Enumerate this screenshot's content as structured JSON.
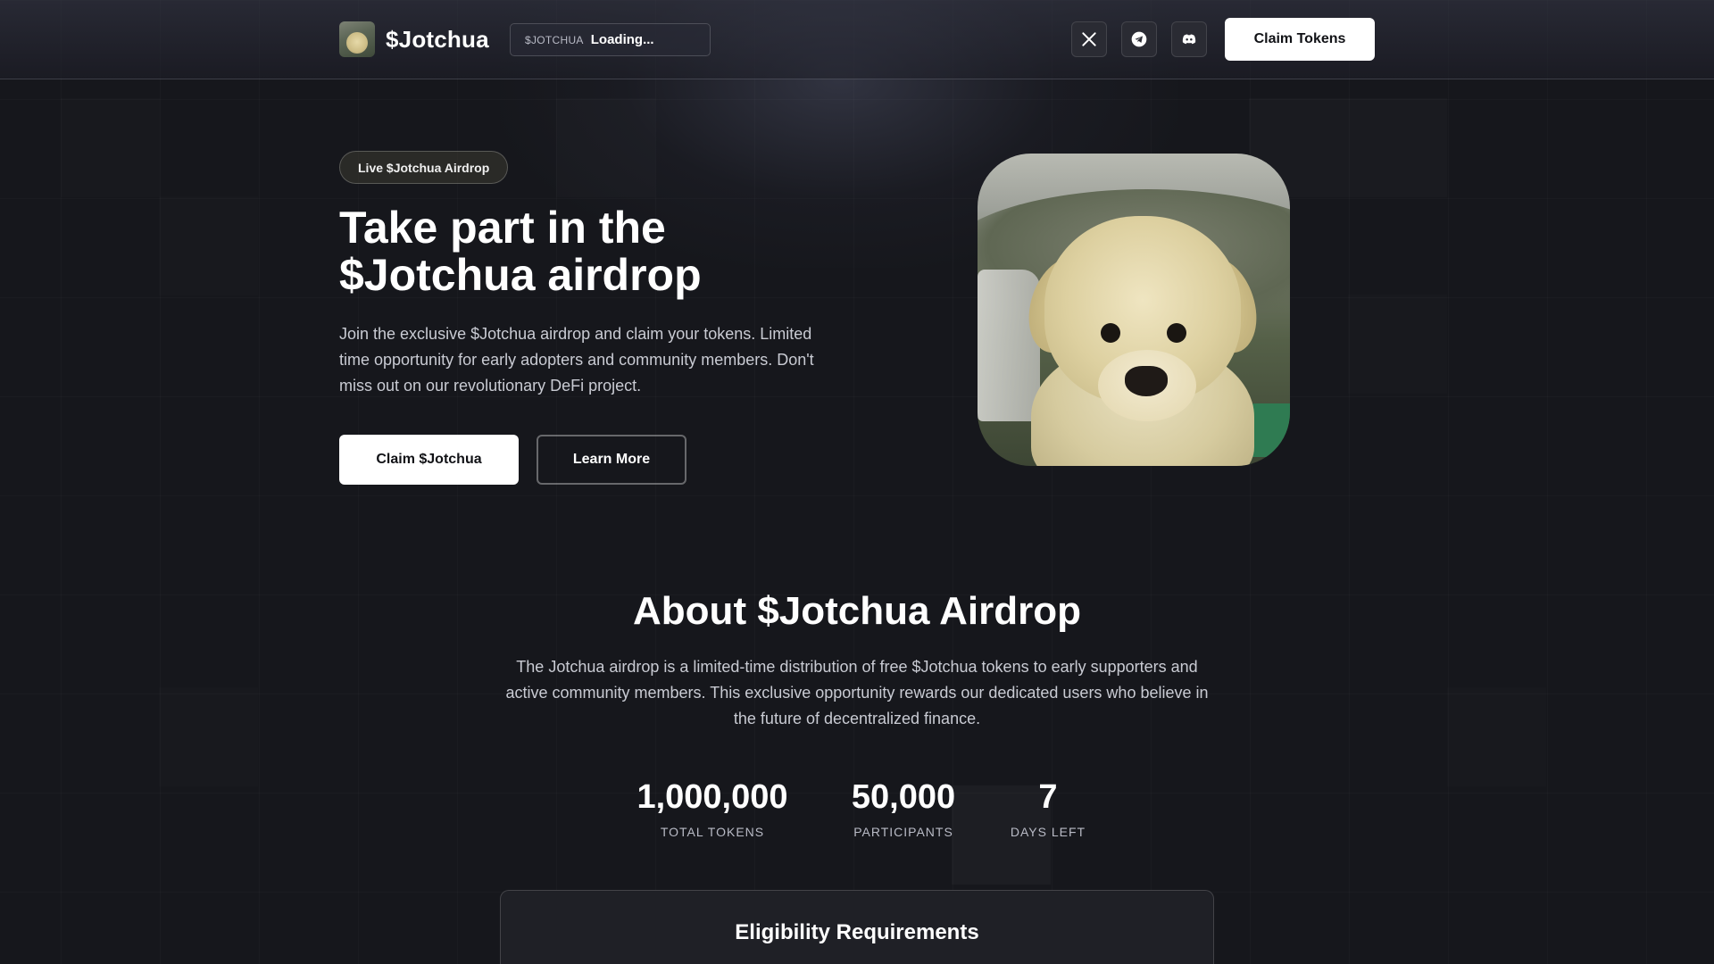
{
  "header": {
    "brand_name": "$Jotchua",
    "ticker_symbol": "$JOTCHUA",
    "ticker_value": "Loading...",
    "claim_label": "Claim Tokens"
  },
  "social": [
    {
      "name": "x-icon"
    },
    {
      "name": "telegram-icon"
    },
    {
      "name": "discord-icon"
    }
  ],
  "hero": {
    "badge": "Live $Jotchua Airdrop",
    "title_line1": "Take part in the",
    "title_line2": "$Jotchua airdrop",
    "description": " Join the exclusive $Jotchua airdrop and claim your tokens. Limited time opportunity for early adopters and community members. Don't miss out on our revolutionary DeFi project.",
    "primary_label": "Claim $Jotchua",
    "secondary_label": "Learn More"
  },
  "about": {
    "title": "About $Jotchua Airdrop",
    "description": "The Jotchua airdrop is a limited-time distribution of free $Jotchua tokens to early supporters and active community members. This exclusive opportunity rewards our dedicated users who believe in the future of decentralized finance.",
    "stats": [
      {
        "value": "1,000,000",
        "label": "TOTAL TOKENS"
      },
      {
        "value": "50,000",
        "label": "PARTICIPANTS"
      },
      {
        "value": "7",
        "label": "DAYS LEFT"
      }
    ]
  },
  "eligibility": {
    "title": "Eligibility Requirements"
  },
  "colors": {
    "background": "#16171c",
    "primary_button": "#ffffff",
    "text_muted": "#c9cbd3"
  }
}
